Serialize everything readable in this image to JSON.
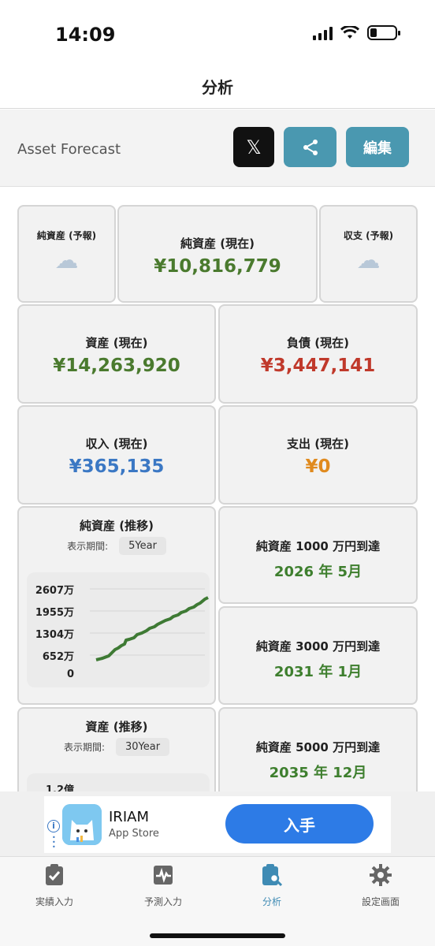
{
  "status": {
    "time": "14:09"
  },
  "nav": {
    "title": "分析"
  },
  "header": {
    "app_name": "Asset Forecast",
    "x_label": "𝕏",
    "edit_label": "編集"
  },
  "cards": {
    "net_forecast_label": "純資産 (予報)",
    "net_current_label": "純資産 (現在)",
    "net_current_value": "¥10,816,779",
    "balance_forecast_label": "収支 (予報)",
    "assets_label": "資産 (現在)",
    "assets_value": "¥14,263,920",
    "liabilities_label": "負債 (現在)",
    "liabilities_value": "¥3,447,141",
    "income_label": "収入 (現在)",
    "income_value": "¥365,135",
    "expense_label": "支出 (現在)",
    "expense_value": "¥0"
  },
  "net_trend": {
    "title": "純資産 (推移)",
    "period_label": "表示期間:",
    "period_value": "5Year",
    "yticks": [
      "2607万",
      "1955万",
      "1304万",
      "652万",
      "0"
    ]
  },
  "asset_trend": {
    "title": "資産 (推移)",
    "period_label": "表示期間:",
    "period_value": "30Year",
    "ytick_top": "1.2億"
  },
  "milestones": [
    {
      "label": "純資産 1000 万円到達",
      "date": "2026 年 5月"
    },
    {
      "label": "純資産 3000 万円到達",
      "date": "2031 年 1月"
    },
    {
      "label": "純資産 5000 万円到達",
      "date": "2035 年 12月"
    }
  ],
  "ad": {
    "title": "IRIAM",
    "subtitle": "App Store",
    "cta": "入手"
  },
  "tabs": [
    {
      "label": "実績入力",
      "icon": "clipboard-check-icon"
    },
    {
      "label": "予測入力",
      "icon": "chart-pulse-icon"
    },
    {
      "label": "分析",
      "icon": "analysis-search-icon"
    },
    {
      "label": "設定画面",
      "icon": "gear-icon"
    }
  ],
  "colors": {
    "accent": "#4a98b0",
    "positive": "#4a7a2e",
    "negative": "#c0392b",
    "income": "#3b78c4",
    "expense": "#e08a1e"
  }
}
